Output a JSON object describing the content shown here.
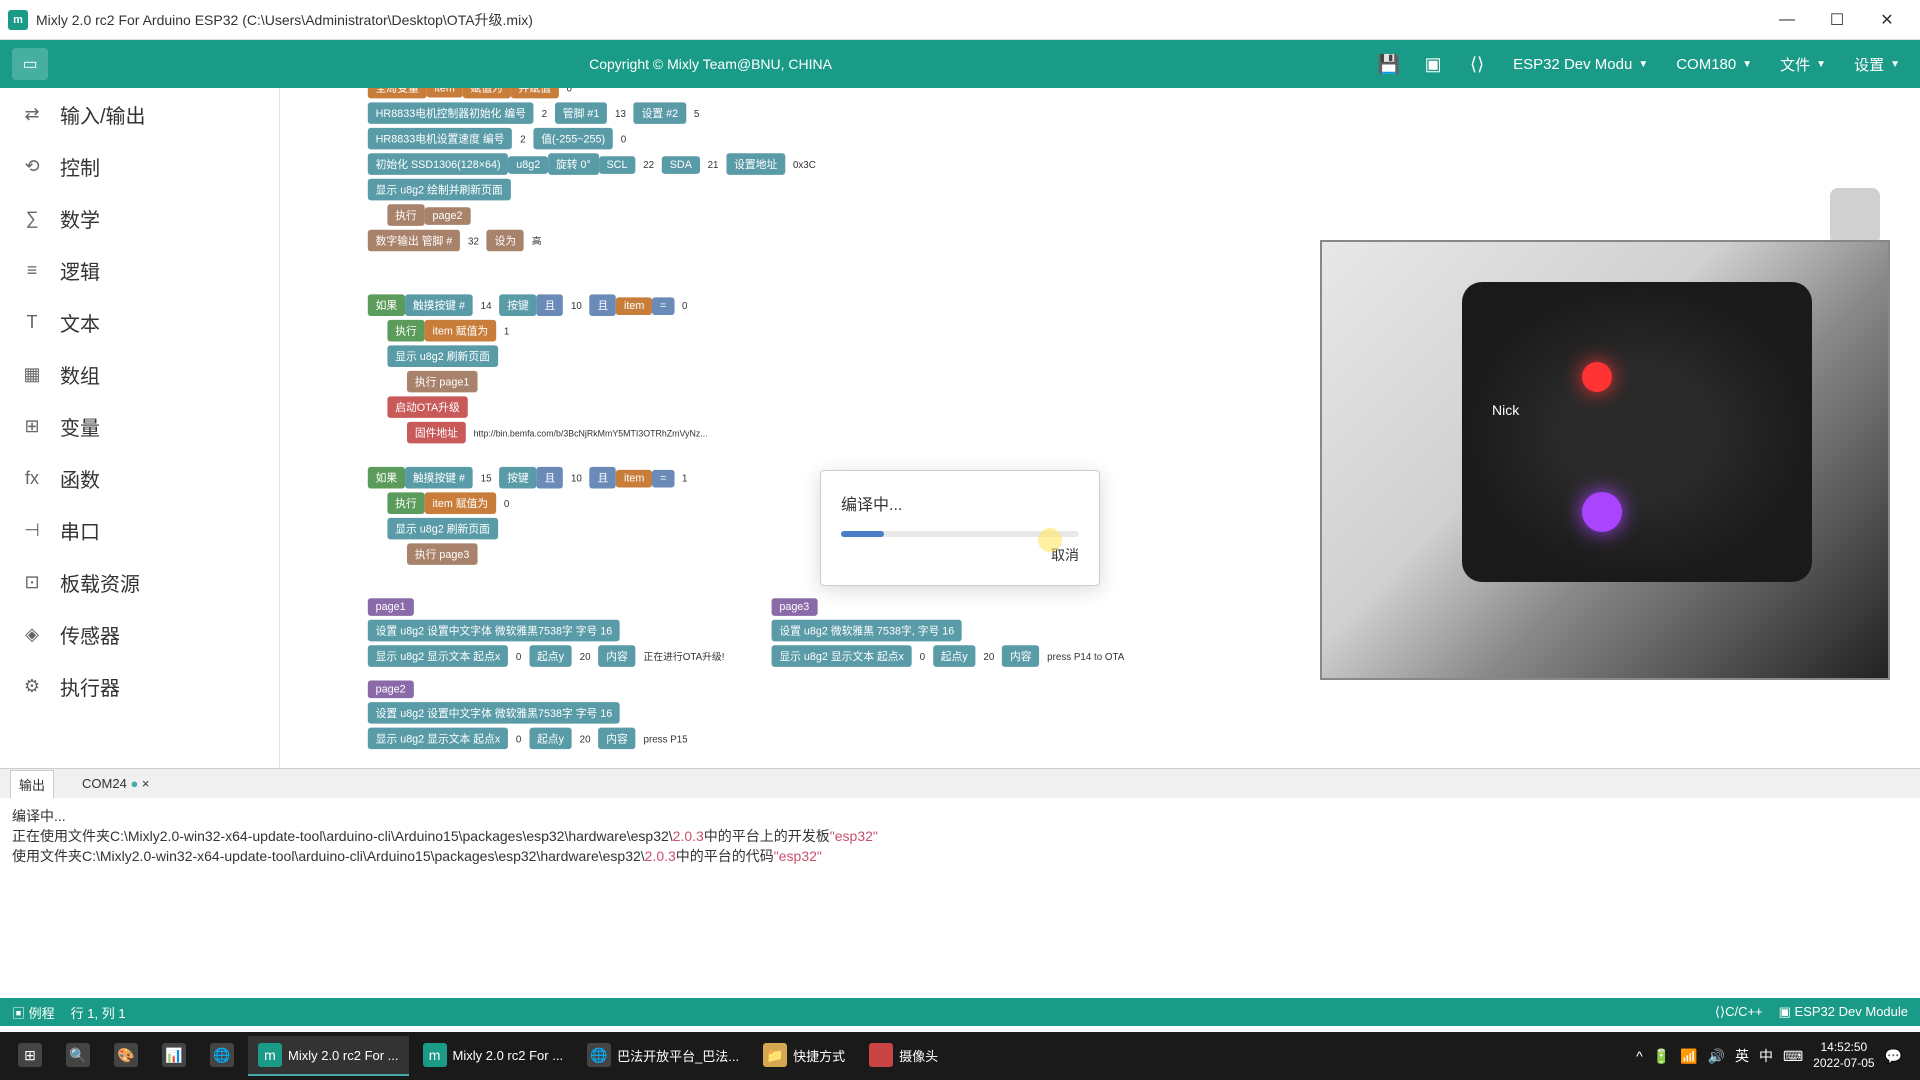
{
  "window": {
    "title": "Mixly 2.0 rc2 For Arduino ESP32 (C:\\Users\\Administrator\\Desktop\\OTA升级.mix)",
    "icon_text": "m"
  },
  "toolbar": {
    "copyright": "Copyright © Mixly Team@BNU, CHINA",
    "board": "ESP32 Dev Modu",
    "port": "COM180",
    "file_menu": "文件",
    "settings_menu": "设置"
  },
  "sidebar": {
    "items": [
      {
        "icon": "⇄",
        "label": "输入/输出"
      },
      {
        "icon": "⟲",
        "label": "控制"
      },
      {
        "icon": "∑",
        "label": "数学"
      },
      {
        "icon": "≡",
        "label": "逻辑"
      },
      {
        "icon": "T",
        "label": "文本"
      },
      {
        "icon": "▦",
        "label": "数组"
      },
      {
        "icon": "⊞",
        "label": "变量"
      },
      {
        "icon": "fx",
        "label": "函数"
      },
      {
        "icon": "⊣",
        "label": "串口"
      },
      {
        "icon": "⊡",
        "label": "板载资源"
      },
      {
        "icon": "◈",
        "label": "传感器"
      },
      {
        "icon": "⚙",
        "label": "执行器"
      }
    ]
  },
  "blocks": {
    "row1_a": "全局变量",
    "row1_b": "item",
    "row1_c": "赋值为",
    "row1_d": "并赋值",
    "hr1": "HR8833电机控制器初始化 编号",
    "hr1_v1": "2",
    "hr1_v2": "13",
    "hr1_v3": "设置 #2",
    "hr2": "HR8833电机设置速度 编号",
    "hr2_v1": "2",
    "hr2_v2": "值(-255~255)",
    "hr2_v3": "0",
    "oled": "初始化 SSD1306(128×64)",
    "oled_u": "u8g2",
    "oled_r": "旋转 0°",
    "oled_scl": "SCL",
    "oled_scl_v": "22",
    "oled_sda": "SDA",
    "oled_sda_v": "21",
    "oled_addr": "设置地址",
    "oled_addr_v": "0x3C",
    "disp1": "显示 u8g2 绘制并刷新页面",
    "exec1": "执行",
    "page2": "page2",
    "digout": "数字输出 管脚 #",
    "digout_v": "32",
    "digout_s": "设为",
    "digout_h": "高",
    "if1": "如果",
    "touch": "触摸按键 #",
    "touch_v": "14",
    "touch_l": "按键",
    "and": "且",
    "item_eq": "item",
    "eq": "=",
    "zero": "0",
    "exec2": "执行",
    "item_set": "item 赋值为",
    "one": "1",
    "disp2": "显示 u8g2 刷新页面",
    "exec_p1": "执行 page1",
    "ota": "启动OTA升级",
    "ota_url": "固件地址",
    "url": "http://bin.bemfa.com/b/3BcNjRkMmY5MTI3OTRhZmVyNz...",
    "if2": "如果",
    "touch2_v": "15",
    "item_set2": "item 赋值为",
    "zero2": "0",
    "disp3": "显示 u8g2 刷新页面",
    "exec_p3": "执行 page3",
    "p1": "page1",
    "p1_font": "设置 u8g2 设置中文字体 微软雅黑7538字 字号 16",
    "p1_disp": "显示 u8g2 显示文本 起点x",
    "p1_x": "0",
    "p1_y": "起点y",
    "p1_yv": "20",
    "p1_c": "内容",
    "p1_t": "正在进行OTA升级!",
    "p3": "page3",
    "p3_font": "设置 u8g2 微软雅黑 7538字, 字号 16",
    "p3_disp": "显示 u8g2 显示文本 起点x",
    "p3_x": "0",
    "p3_y": "起点y",
    "p3_yv": "20",
    "p3_c": "内容",
    "p3_t": "press P14 to OTA",
    "p2": "page2",
    "p2_font": "设置 u8g2 设置中文字体 微软雅黑7538字 字号 16",
    "p2_disp": "显示 u8g2 显示文本 起点x",
    "p2_x": "0",
    "p2_y": "起点y",
    "p2_yv": "20",
    "p2_c": "内容",
    "p2_t": "press P15"
  },
  "dialog": {
    "title": "编译中...",
    "cancel": "取消"
  },
  "output_tabs": {
    "tab1": "输出",
    "tab2": "COM24"
  },
  "output": {
    "line1": "编译中...",
    "line2a": "正在使用文件夹C:\\Mixly2.0-win32-x64-update-tool\\arduino-cli\\Arduino15\\packages\\esp32\\hardware\\esp32\\",
    "line2v": "2.0.3",
    "line2b": "中的平台上的开发板",
    "line2q": "\"esp32\"",
    "line3a": "使用文件夹C:\\Mixly2.0-win32-x64-update-tool\\arduino-cli\\Arduino15\\packages\\esp32\\hardware\\esp32\\",
    "line3v": "2.0.3",
    "line3b": "中的平台的代码",
    "line3q": "\"esp32\""
  },
  "statusbar": {
    "example": "例程",
    "cursor": "行 1, 列 1",
    "lang": "C/C++",
    "board": "ESP32 Dev Module"
  },
  "taskbar": {
    "items": [
      {
        "icon": "⊞",
        "label": ""
      },
      {
        "icon": "🔍",
        "label": ""
      },
      {
        "icon": "🎨",
        "label": ""
      },
      {
        "icon": "📊",
        "label": ""
      },
      {
        "icon": "🌐",
        "label": ""
      },
      {
        "icon": "m",
        "label": "Mixly 2.0 rc2 For ..."
      },
      {
        "icon": "m",
        "label": "Mixly 2.0 rc2 For ..."
      },
      {
        "icon": "🌐",
        "label": "巴法开放平台_巴法..."
      },
      {
        "icon": "📁",
        "label": "快捷方式"
      },
      {
        "icon": "●",
        "label": "摄像头"
      }
    ],
    "time": "14:52:50",
    "date": "2022-07-05"
  },
  "camera": {
    "nick": "Nick"
  }
}
